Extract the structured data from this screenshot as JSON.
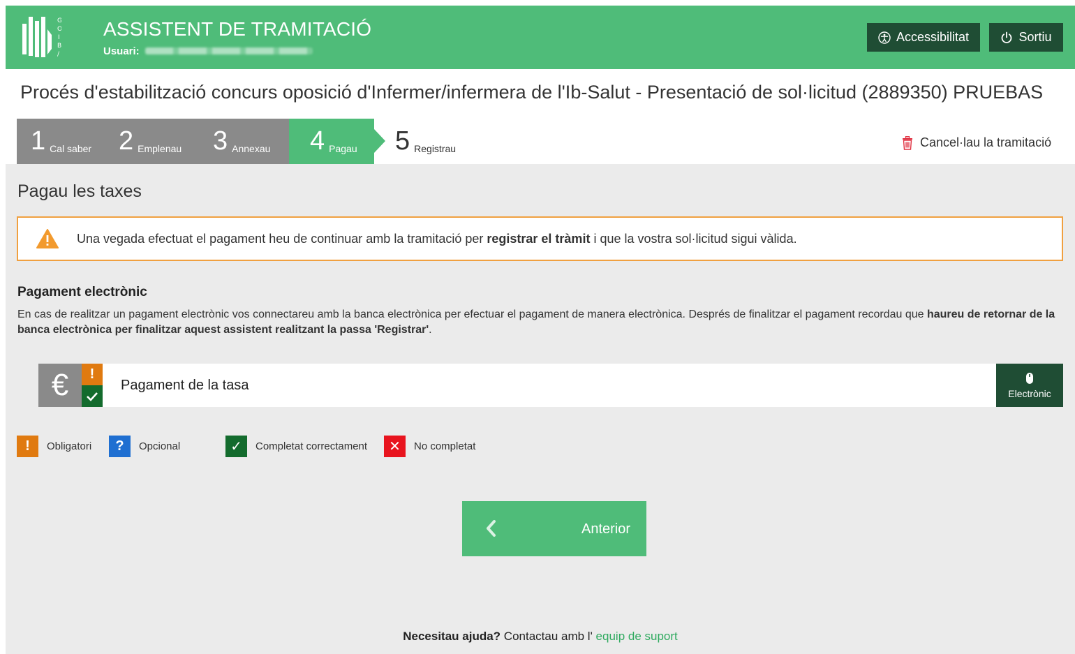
{
  "header": {
    "app_title": "ASSISTENT DE TRAMITACIÓ",
    "user_label": "Usuari:",
    "logo_letters": "GOIB/",
    "accessibility_label": "Accessibilitat",
    "exit_label": "Sortiu"
  },
  "procedure": {
    "title": "Procés d'estabilització concurs oposició d'Infermer/infermera de l'Ib-Salut - Presentació de sol·licitud (2889350) PRUEBAS"
  },
  "steps": [
    {
      "num": "1",
      "label": "Cal saber",
      "state": "done"
    },
    {
      "num": "2",
      "label": "Emplenau",
      "state": "done"
    },
    {
      "num": "3",
      "label": "Annexau",
      "state": "done"
    },
    {
      "num": "4",
      "label": "Pagau",
      "state": "active"
    },
    {
      "num": "5",
      "label": "Registrau",
      "state": "pending"
    }
  ],
  "cancel_label": "Cancel·lau la tramitació",
  "main": {
    "section_title": "Pagau les taxes",
    "warning": {
      "before": "Una vegada efectuat el pagament heu de continuar amb la tramitació per ",
      "bold": "registrar el tràmit",
      "after": " i que la vostra sol·licitud sigui vàlida."
    },
    "payment": {
      "title": "Pagament electrònic",
      "desc_normal": "En cas de realitzar un pagament electrònic vos connectareu amb la banca electrònica per efectuar el pagament de manera electrònica. Després de finalitzar el pagament recordau que ",
      "desc_bold": "haureu de retornar de la banca electrònica per finalitzar aquest assistent realitzant la passa 'Registrar'",
      "desc_end": "."
    },
    "tasa": {
      "currency_symbol": "€",
      "label": "Pagament de la tasa",
      "button_label": "Electrònic"
    },
    "legend": [
      {
        "symbol": "!",
        "label": "Obligatori",
        "color": "#e07a10"
      },
      {
        "symbol": "?",
        "label": "Opcional",
        "color": "#1f6fd1"
      },
      {
        "symbol": "✓",
        "label": "Completat correctament",
        "color": "#136b2d"
      },
      {
        "symbol": "✕",
        "label": "No completat",
        "color": "#e8141e"
      }
    ],
    "previous_button": "Anterior"
  },
  "footer": {
    "help_bold": "Necesitau ajuda?",
    "help_text": " Contactau amb l' ",
    "help_link": "equip de suport"
  },
  "colors": {
    "brand_green": "#4fbc79",
    "dark_green": "#1f4d34",
    "warning_orange": "#f0a040"
  }
}
